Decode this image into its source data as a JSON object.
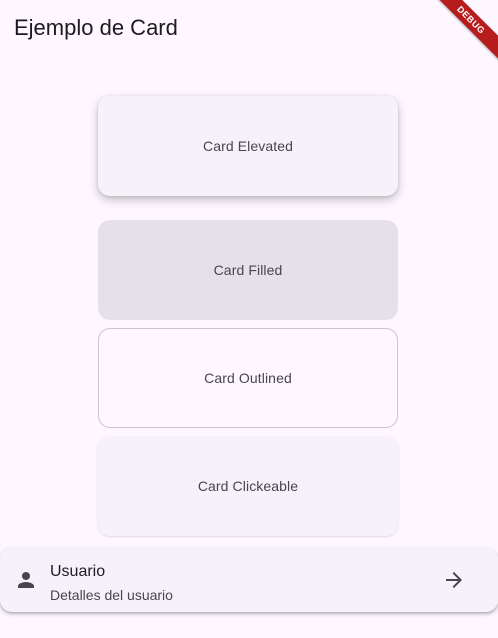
{
  "appbar": {
    "title": "Ejemplo de Card"
  },
  "debug_banner": {
    "label": "DEBUG"
  },
  "cards": {
    "elevated": "Card Elevated",
    "filled": "Card Filled",
    "outlined": "Card Outlined",
    "clickeable": "Card Clickeable"
  },
  "list_tile": {
    "leading_icon": "person-icon",
    "title": "Usuario",
    "subtitle": "Detalles del usuario",
    "trailing_icon": "arrow-forward-icon"
  },
  "colors": {
    "background": "#fef7ff",
    "surface_container_low": "#f7f2fa",
    "surface_container_highest": "#e6e0e9",
    "outline_variant": "#cac4d0",
    "debug_banner": "#b71c1c"
  }
}
